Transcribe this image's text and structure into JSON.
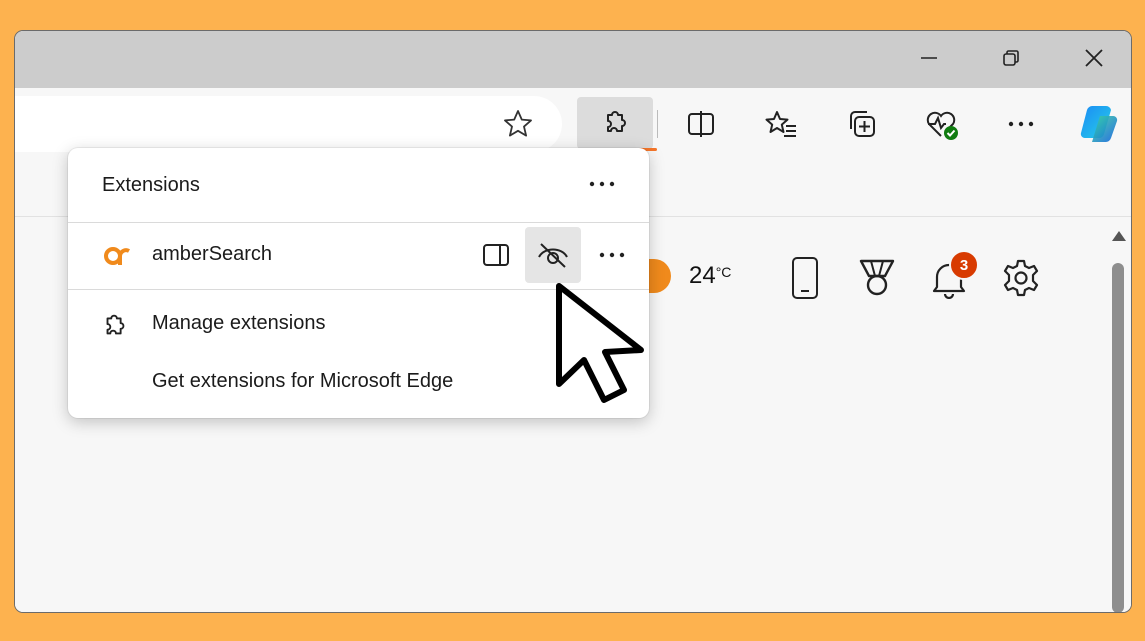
{
  "colors": {
    "background": "#FDB24F",
    "accent_underline": "#F5762A",
    "badge": "#D83B01",
    "amber_logo": "#F08A1C"
  },
  "window_controls": [
    "minimize-icon",
    "restore-icon",
    "close-icon"
  ],
  "toolbar": {
    "icons": [
      "favorite-star-icon",
      "extensions-icon",
      "split-screen-icon",
      "favorites-icon",
      "collections-icon",
      "browser-essentials-icon",
      "more-icon",
      "copilot-icon"
    ]
  },
  "page": {
    "temperature": "24",
    "temperature_unit": "°C",
    "notification_count": "3",
    "icons": [
      "phone-icon",
      "rewards-medal-icon",
      "notifications-bell-icon",
      "settings-gear-icon"
    ]
  },
  "extensions_panel": {
    "title": "Extensions",
    "extension": {
      "name": "amberSearch"
    },
    "menu": [
      {
        "label": "Manage extensions",
        "icon": "puzzle-icon"
      },
      {
        "label": "Get extensions for Microsoft Edge",
        "icon": ""
      }
    ]
  }
}
